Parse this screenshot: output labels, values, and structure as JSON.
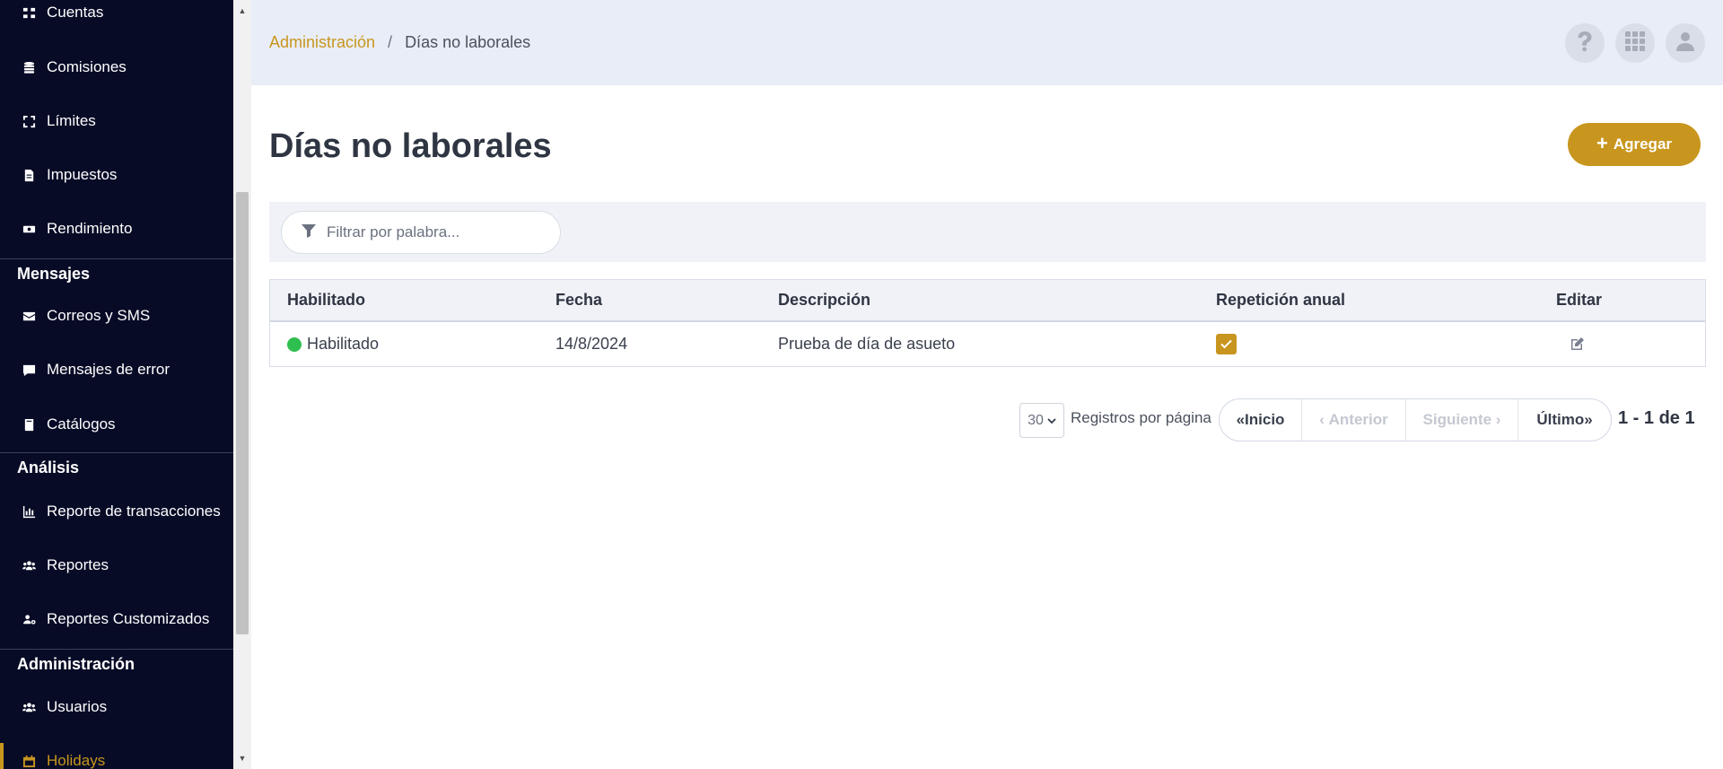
{
  "sidebar": {
    "items": [
      {
        "label": "Cuentas",
        "icon": "accounts-icon"
      },
      {
        "label": "Comisiones",
        "icon": "coins-icon"
      },
      {
        "label": "Límites",
        "icon": "expand-icon"
      },
      {
        "label": "Impuestos",
        "icon": "file-invoice-icon"
      },
      {
        "label": "Rendimiento",
        "icon": "money-bill-icon"
      }
    ],
    "sections": [
      {
        "title": "Mensajes",
        "items": [
          {
            "label": "Correos y SMS",
            "icon": "envelope-icon"
          },
          {
            "label": "Mensajes de error",
            "icon": "comment-icon"
          },
          {
            "label": "Catálogos",
            "icon": "book-icon"
          }
        ]
      },
      {
        "title": "Análisis",
        "items": [
          {
            "label": "Reporte de transacciones",
            "icon": "chart-bar-icon"
          },
          {
            "label": "Reportes",
            "icon": "users-icon"
          },
          {
            "label": "Reportes Customizados",
            "icon": "users-cog-icon"
          }
        ]
      },
      {
        "title": "Administración",
        "items": [
          {
            "label": "Usuarios",
            "icon": "users-icon"
          },
          {
            "label": "Holidays",
            "icon": "calendar-icon",
            "active": true
          }
        ]
      }
    ]
  },
  "header": {
    "breadcrumb": {
      "parent": "Administración",
      "separator": "/",
      "current": "Días no laborales"
    },
    "buttons": [
      "help-icon",
      "apps-grid-icon",
      "user-icon"
    ]
  },
  "page": {
    "title": "Días no laborales",
    "add_label": "Agregar"
  },
  "filter": {
    "placeholder": "Filtrar por palabra..."
  },
  "table": {
    "columns": [
      "Habilitado",
      "Fecha",
      "Descripción",
      "Repetición anual",
      "Editar"
    ],
    "rows": [
      {
        "status": "Habilitado",
        "date": "14/8/2024",
        "description": "Prueba de día de asueto",
        "annual_repeat": true
      }
    ]
  },
  "pagination": {
    "page_size": "30",
    "per_page_label": "Registros por página",
    "first": "Inicio",
    "prev": "Anterior",
    "next": "Siguiente",
    "last": "Último",
    "range": "1 - 1 de 1"
  },
  "colors": {
    "accent": "#c8961e",
    "sidebar_bg": "#070b26",
    "header_bg": "#e9edf7",
    "status_enabled": "#2fbf4f"
  }
}
